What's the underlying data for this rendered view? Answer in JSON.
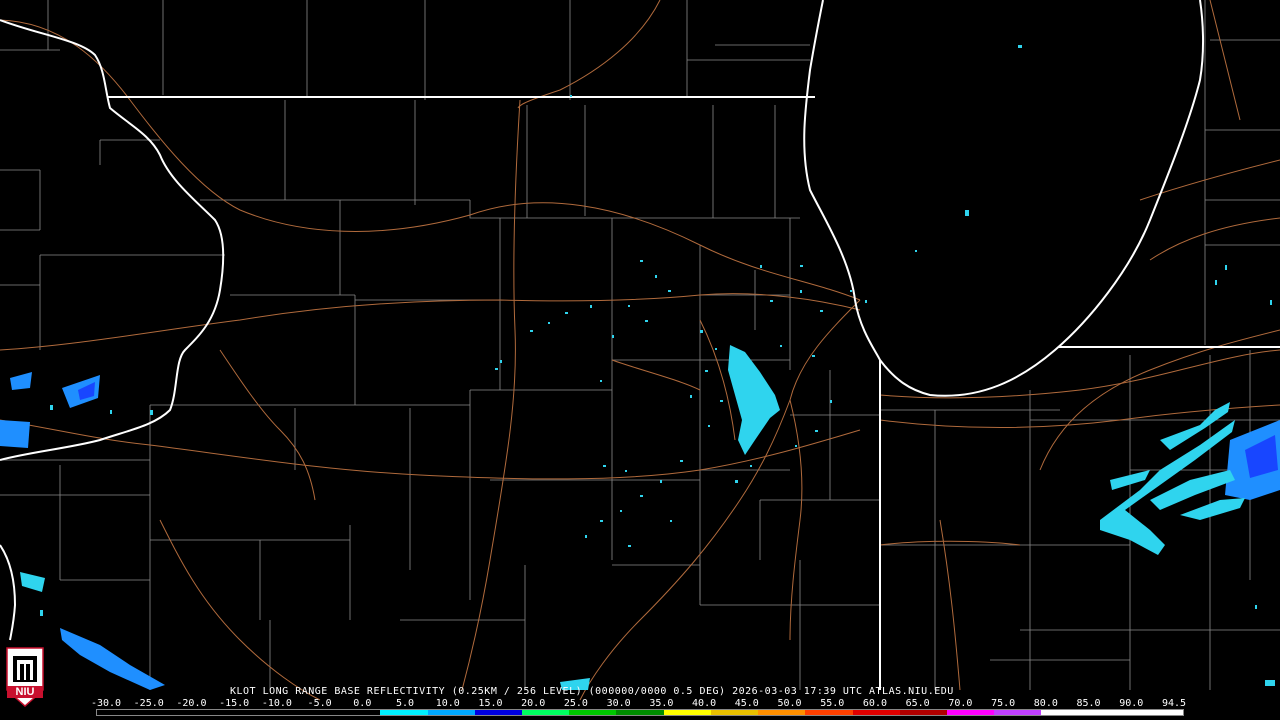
{
  "title": "KLOT LONG RANGE BASE REFLECTIVITY (0.25KM / 256 LEVEL) (000000/0000 0.5 DEG) 2026-03-03 17:39 UTC  ATLAS.NIU.EDU",
  "logo_text": "NIU",
  "legend": {
    "ticks": [
      "-30.0",
      "-25.0",
      "-20.0",
      "-15.0",
      "-10.0",
      "-5.0",
      "0.0",
      "5.0",
      "10.0",
      "15.0",
      "20.0",
      "25.0",
      "30.0",
      "35.0",
      "40.0",
      "45.0",
      "50.0",
      "55.0",
      "60.0",
      "65.0",
      "70.0",
      "75.0",
      "80.0",
      "85.0",
      "90.0",
      "94.5"
    ],
    "colors": [
      "#000000",
      "#000000",
      "#000000",
      "#000000",
      "#000000",
      "#000000",
      "#00f0ff",
      "#00a8ff",
      "#0000e0",
      "#00ff60",
      "#00c800",
      "#008c00",
      "#ffff00",
      "#e8c000",
      "#ff9000",
      "#ff4000",
      "#e00000",
      "#b00000",
      "#ff00ff",
      "#c040ff",
      "#ffffff",
      "#ffffff",
      "#ffffff"
    ]
  },
  "colors": {
    "state_border": "#ffffff",
    "county_border": "#8a8a8a",
    "highway": "#b06a3c",
    "echo_light": "#2fd4ee",
    "echo_medium": "#1f8fff",
    "echo_strong": "#1846ff"
  }
}
